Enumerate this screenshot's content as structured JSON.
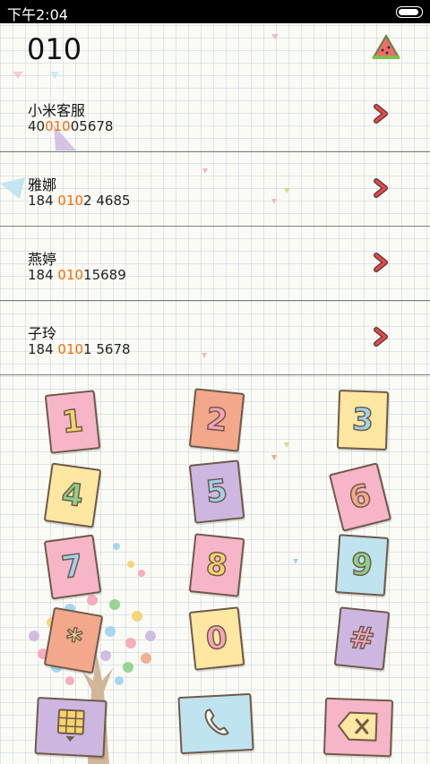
{
  "status_bar": {
    "time": "下午2:04"
  },
  "search": {
    "query": "010"
  },
  "colors": {
    "match_highlight": "#ff6a00",
    "chevron": "#e84b4b"
  },
  "contacts": [
    {
      "name": "小米客服",
      "pre": "40",
      "match": "010",
      "post": "05678"
    },
    {
      "name": "雅娜",
      "pre": "184 ",
      "match": "010",
      "post": "2 4685"
    },
    {
      "name": "燕婷",
      "pre": "184 ",
      "match": "010",
      "post": "15689"
    },
    {
      "name": "子玲",
      "pre": "184 ",
      "match": "010",
      "post": "1 5678"
    }
  ],
  "keypad": {
    "keys": [
      {
        "label": "1",
        "color": "#f6b6c8",
        "text_color": "#f6d46a"
      },
      {
        "label": "2",
        "color": "#f3a88b",
        "text_color": "#f7a5b9"
      },
      {
        "label": "3",
        "color": "#fde7a1",
        "text_color": "#9fd3ef"
      },
      {
        "label": "4",
        "color": "#fde7a1",
        "text_color": "#8ed08a"
      },
      {
        "label": "5",
        "color": "#cdb7e0",
        "text_color": "#9fd3ef"
      },
      {
        "label": "6",
        "color": "#f6b6c8",
        "text_color": "#f3a88b"
      },
      {
        "label": "7",
        "color": "#f6b6c8",
        "text_color": "#9fd3ef"
      },
      {
        "label": "8",
        "color": "#f6b6c8",
        "text_color": "#f6d46a"
      },
      {
        "label": "9",
        "color": "#bfe3ef",
        "text_color": "#8ed08a"
      },
      {
        "label": "*",
        "color": "#f3a88b",
        "text_color": "#fde7a1"
      },
      {
        "label": "0",
        "color": "#fde7a1",
        "text_color": "#f7a5b9"
      },
      {
        "label": "#",
        "color": "#cdb7e0",
        "text_color": "#f7a5b9"
      }
    ]
  },
  "bottom_bar": {
    "dialpad_toggle_icon": "keypad-grid-icon",
    "call_icon": "phone-handset-icon",
    "backspace_icon": "backspace-x-icon"
  }
}
